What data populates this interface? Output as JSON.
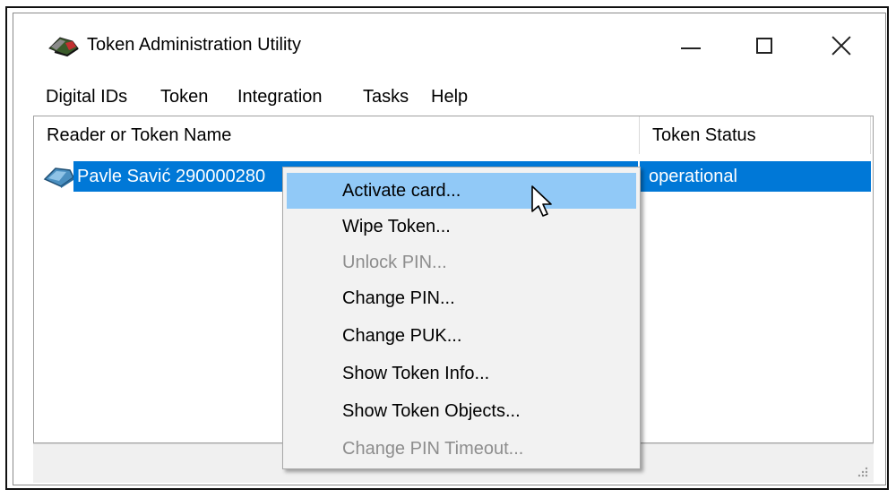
{
  "window": {
    "title": "Token Administration Utility",
    "icon": "token-reader-icon",
    "controls": {
      "minimize": "minimize-icon",
      "maximize": "maximize-icon",
      "close": "close-icon"
    }
  },
  "menubar": {
    "items": [
      "Digital IDs",
      "Token",
      "Integration",
      "Tasks",
      "Help"
    ]
  },
  "listview": {
    "columns": [
      "Reader or Token Name",
      "Token Status"
    ],
    "rows": [
      {
        "name": "Pavle Savić 290000280",
        "status": "operational",
        "selected": true,
        "icon": "token-icon"
      }
    ]
  },
  "context_menu": {
    "items": [
      {
        "label": "Activate card...",
        "state": "hover"
      },
      {
        "label": "Wipe Token...",
        "state": "enabled"
      },
      {
        "label": "Unlock PIN...",
        "state": "disabled"
      },
      {
        "label": "Change PIN...",
        "state": "enabled"
      },
      {
        "label": "Change PUK...",
        "state": "enabled"
      },
      {
        "label": "Show Token Info...",
        "state": "enabled"
      },
      {
        "label": "Show Token Objects...",
        "state": "enabled"
      },
      {
        "label": "Change PIN Timeout...",
        "state": "disabled"
      }
    ]
  },
  "colors": {
    "selection": "#0078d7",
    "menu_hover": "#91c9f7",
    "disabled_text": "#8d8d8d"
  }
}
